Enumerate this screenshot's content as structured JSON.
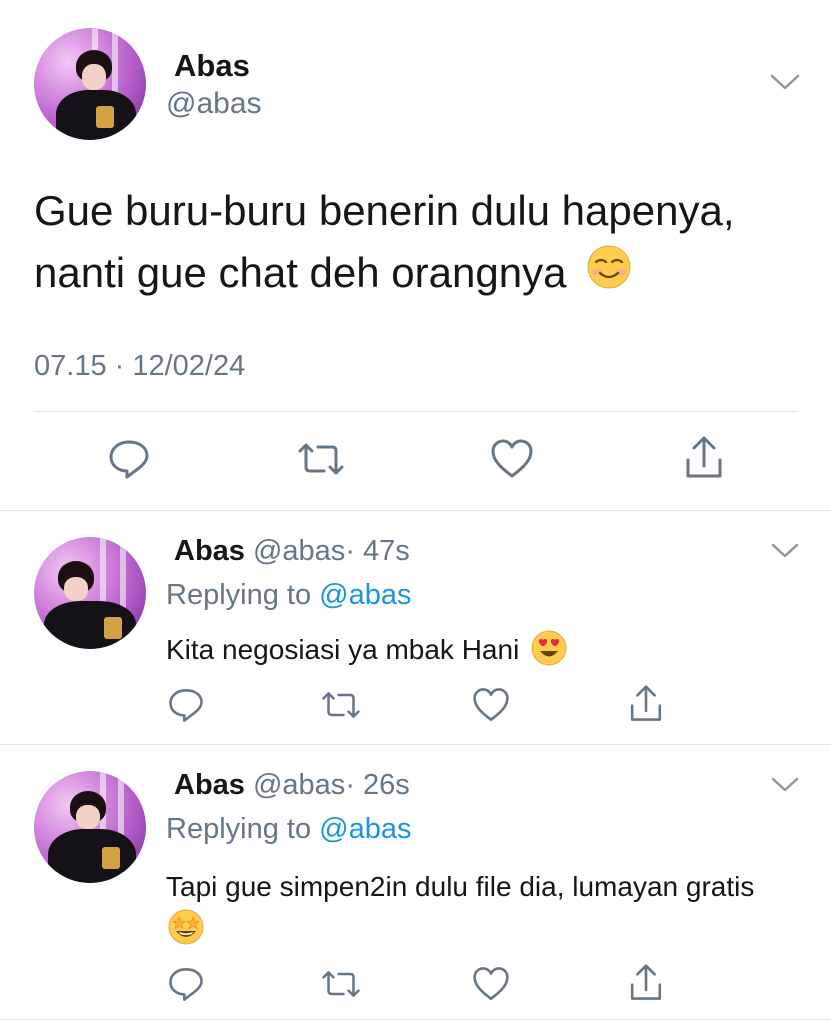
{
  "main_tweet": {
    "display_name": "Abas",
    "handle": "@abas",
    "text": "Gue buru-buru benerin dulu hapenya,\nnanti gue chat deh orangnya",
    "emoji": "smiling-face-emoji",
    "timestamp": "07.15 · 12/02/24"
  },
  "replies": [
    {
      "display_name": "Abas",
      "handle": "@abas",
      "time": "· 47s",
      "replying_label": "Replying to",
      "replying_to": "@abas",
      "text": "Kita negosiasi ya mbak Hani",
      "emoji": "heart-eyes-emoji"
    },
    {
      "display_name": "Abas",
      "handle": "@abas",
      "time": "· 26s",
      "replying_label": "Replying to",
      "replying_to": "@abas",
      "text": "Tapi gue simpen2in dulu file dia, lumayan gratis",
      "emoji": "star-struck-emoji"
    }
  ],
  "colors": {
    "text": "#14171a",
    "secondary": "#657786",
    "link": "#1b95e0",
    "divider": "#e1e8ed",
    "icon": "#657786"
  }
}
